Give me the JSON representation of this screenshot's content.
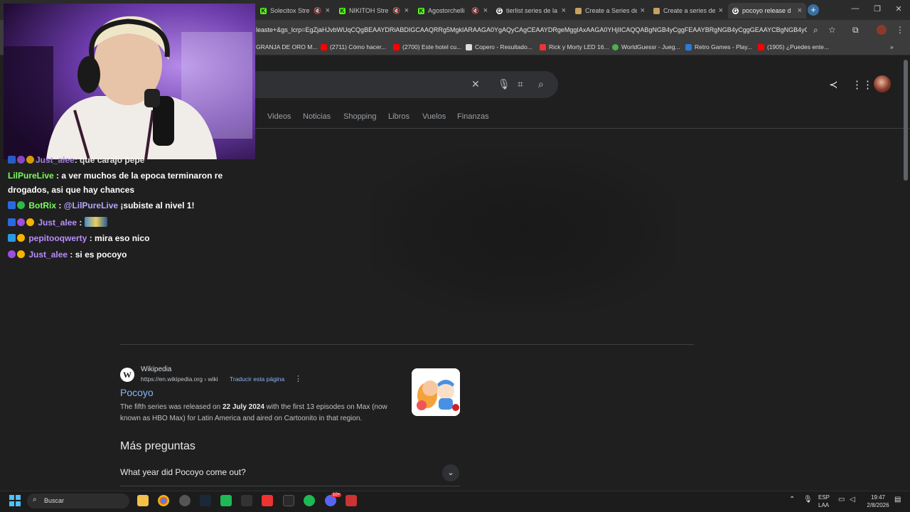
{
  "browser": {
    "tabs": [
      {
        "title": "Solecitox Stre",
        "icon_color": "#53fc18",
        "icon_letter": "K"
      },
      {
        "title": "NIKITOH Stre",
        "icon_color": "#53fc18",
        "icon_letter": "K"
      },
      {
        "title": "Agostorchelli",
        "icon_color": "#53fc18",
        "icon_letter": "K"
      },
      {
        "title": "tierlist series de la",
        "icon_color": "#ffffff",
        "icon_letter": "G"
      },
      {
        "title": "Create a Series de",
        "icon_color": "#c8a060",
        "icon_letter": ""
      },
      {
        "title": "Create a series de",
        "icon_color": "#c8a060",
        "icon_letter": ""
      },
      {
        "title": "pocoyo release d",
        "icon_color": "#ffffff",
        "icon_letter": "G"
      }
    ],
    "new_tab": "+",
    "window_controls": {
      "minimize": "—",
      "restore": "❐",
      "close": "✕"
    },
    "url": "leaste+&gs_lcrp=EgZjaHJvbWUqCQgBEAAYDRiABDIGCAAQRRg5MgkIARAAGA0YgAQyCAgCEAAYDRgeMggIAxAAGA0YHjIICAQQABgNGB4yCggFEAAYBRgNGB4yCggGEAAYCBgNGB4yCg...",
    "bookmarks": [
      {
        "label": "GRANJA DE ORO M...",
        "color": "#c8a040"
      },
      {
        "label": "(2711) Cómo hacer...",
        "color": "#ff0000"
      },
      {
        "label": "(2700) Este hotel cu...",
        "color": "#ff0000"
      },
      {
        "label": "Copero - Resultado...",
        "color": "#dddddd"
      },
      {
        "label": "Rick y Morty LED 16...",
        "color": "#e33"
      },
      {
        "label": "WorldGuessr - Jueg...",
        "color": "#4caf50"
      },
      {
        "label": "Retro Games - Play...",
        "color": "#2a7ad6"
      },
      {
        "label": "(1905) ¿Puedes ente...",
        "color": "#ff0000"
      }
    ],
    "bookmarks_more": "»"
  },
  "google": {
    "nav": [
      "Videos",
      "Noticias",
      "Shopping",
      "Libros",
      "Vuelos",
      "Finanzas"
    ],
    "result": {
      "source": "Wikipedia",
      "url": "https://en.wikipedia.org › wiki",
      "translate": "Traducir esta página",
      "title": "Pocoyo",
      "snippet_pre": "The fifth series was released on ",
      "snippet_bold": "22 July 2024",
      "snippet_post": " with the first 13 episodes on Max (now known as HBO Max) for Latin America and aired on Cartoonito in that region.",
      "logo_letter": "W"
    },
    "more_questions_title": "Más preguntas",
    "questions": [
      "What year did Pocoyo come out?"
    ]
  },
  "chat": [
    {
      "user": "Just_alee",
      "text": ": que carajo pepe",
      "color": "#b98cff"
    },
    {
      "user": "LilPureLive",
      "text": ": a ver muchos de la epoca terminaron re",
      "color": "#7cfc5c",
      "cont": "drogados, asi que hay chances"
    },
    {
      "user": "BotRix",
      "text": ": ",
      "mention": "@LilPureLive",
      "after": " ¡subiste al nivel 1!",
      "color": "#7cfc5c"
    },
    {
      "user": "Just_alee",
      "text": ": ",
      "color": "#b98cff"
    },
    {
      "user": "pepitooqwerty",
      "text": ": mira eso nico",
      "color": "#b98cff"
    },
    {
      "user": "Just_alee",
      "text": ": si es pocoyo",
      "color": "#b98cff"
    }
  ],
  "taskbar": {
    "search_placeholder": "Buscar",
    "lang": "ESP",
    "lang2": "LAA",
    "time": "19:47",
    "date": "2/8/2026",
    "discord_badge": "10+"
  }
}
